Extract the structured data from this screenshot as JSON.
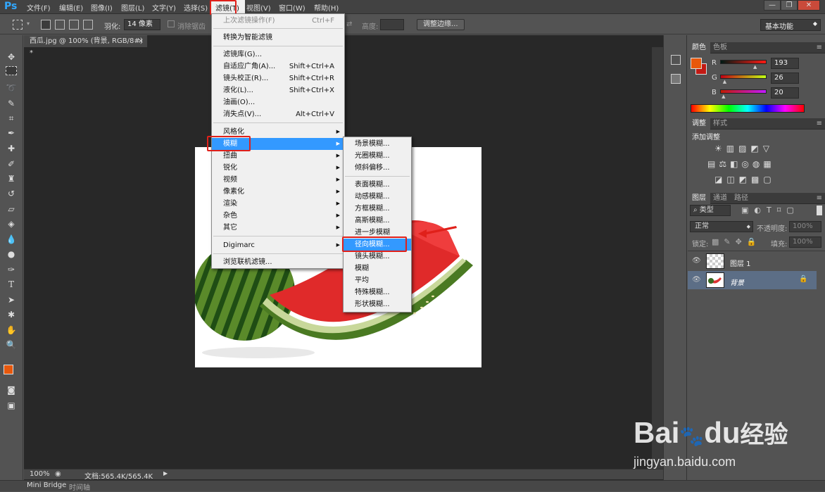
{
  "app": {
    "logo": "Ps"
  },
  "menubar": {
    "items": [
      "文件(F)",
      "编辑(E)",
      "图像(I)",
      "图层(L)",
      "文字(Y)",
      "选择(S)",
      "滤镜(T)",
      "视图(V)",
      "窗口(W)",
      "帮助(H)"
    ],
    "window_buttons": [
      "—",
      "❐",
      "✕"
    ]
  },
  "options": {
    "feather_label": "羽化:",
    "feather_value": "14 像素",
    "antialias_label": "消除锯齿",
    "height_label": "高度:",
    "refine_edge": "调整边缘...",
    "workspace": "基本功能"
  },
  "document": {
    "tab_title": "西瓜.jpg @ 100% (背景, RGB/8#) *",
    "zoom": "100%",
    "doc_info": "文档:565.4K/565.4K"
  },
  "bottom_tabs": [
    "Mini Bridge",
    "时间轴"
  ],
  "filter_menu": {
    "items": [
      {
        "label": "上次滤镜操作(F)",
        "shortcut": "Ctrl+F",
        "disabled": true
      },
      {
        "label": "转换为智能滤镜"
      },
      {
        "label": "滤镜库(G)..."
      },
      {
        "label": "自适应广角(A)...",
        "shortcut": "Shift+Ctrl+A"
      },
      {
        "label": "镜头校正(R)...",
        "shortcut": "Shift+Ctrl+R"
      },
      {
        "label": "液化(L)...",
        "shortcut": "Shift+Ctrl+X"
      },
      {
        "label": "油画(O)..."
      },
      {
        "label": "消失点(V)...",
        "shortcut": "Alt+Ctrl+V"
      },
      {
        "label": "风格化",
        "submenu": true
      },
      {
        "label": "模糊",
        "submenu": true,
        "highlighted": true
      },
      {
        "label": "扭曲",
        "submenu": true
      },
      {
        "label": "锐化",
        "submenu": true
      },
      {
        "label": "视频",
        "submenu": true
      },
      {
        "label": "像素化",
        "submenu": true
      },
      {
        "label": "渲染",
        "submenu": true
      },
      {
        "label": "杂色",
        "submenu": true
      },
      {
        "label": "其它",
        "submenu": true
      },
      {
        "label": "Digimarc",
        "submenu": true
      },
      {
        "label": "浏览联机滤镜..."
      }
    ]
  },
  "blur_submenu": {
    "items": [
      {
        "label": "场景模糊..."
      },
      {
        "label": "光圈模糊..."
      },
      {
        "label": "倾斜偏移..."
      },
      {
        "label": "表面模糊..."
      },
      {
        "label": "动感模糊..."
      },
      {
        "label": "方框模糊..."
      },
      {
        "label": "高斯模糊..."
      },
      {
        "label": "进一步模糊"
      },
      {
        "label": "径向模糊...",
        "highlighted": true
      },
      {
        "label": "镜头模糊..."
      },
      {
        "label": "模糊"
      },
      {
        "label": "平均"
      },
      {
        "label": "特殊模糊..."
      },
      {
        "label": "形状模糊..."
      }
    ]
  },
  "color_panel": {
    "tabs": [
      "颜色",
      "色板"
    ],
    "channels": [
      {
        "label": "R",
        "value": "193",
        "fraction": 0.757
      },
      {
        "label": "G",
        "value": "26",
        "fraction": 0.102
      },
      {
        "label": "B",
        "value": "20",
        "fraction": 0.078
      }
    ],
    "foreground": "#c11a14",
    "accent_fg": "#e8580c"
  },
  "adjust_panel": {
    "tabs": [
      "调整",
      "样式"
    ],
    "title": "添加调整"
  },
  "layers_panel": {
    "tabs": [
      "图层",
      "通道",
      "路径"
    ],
    "filter_kind": "类型",
    "blend_mode": "正常",
    "opacity_label": "不透明度:",
    "opacity_value": "100%",
    "lock_label": "锁定:",
    "fill_label": "填充:",
    "fill_value": "100%",
    "layers": [
      {
        "name": "图层 1",
        "selected": false
      },
      {
        "name": "背景",
        "selected": true
      }
    ]
  },
  "watermark": {
    "text1": "Bai",
    "text2": "du",
    "text3": "经验",
    "url": "jingyan.baidu.com"
  }
}
